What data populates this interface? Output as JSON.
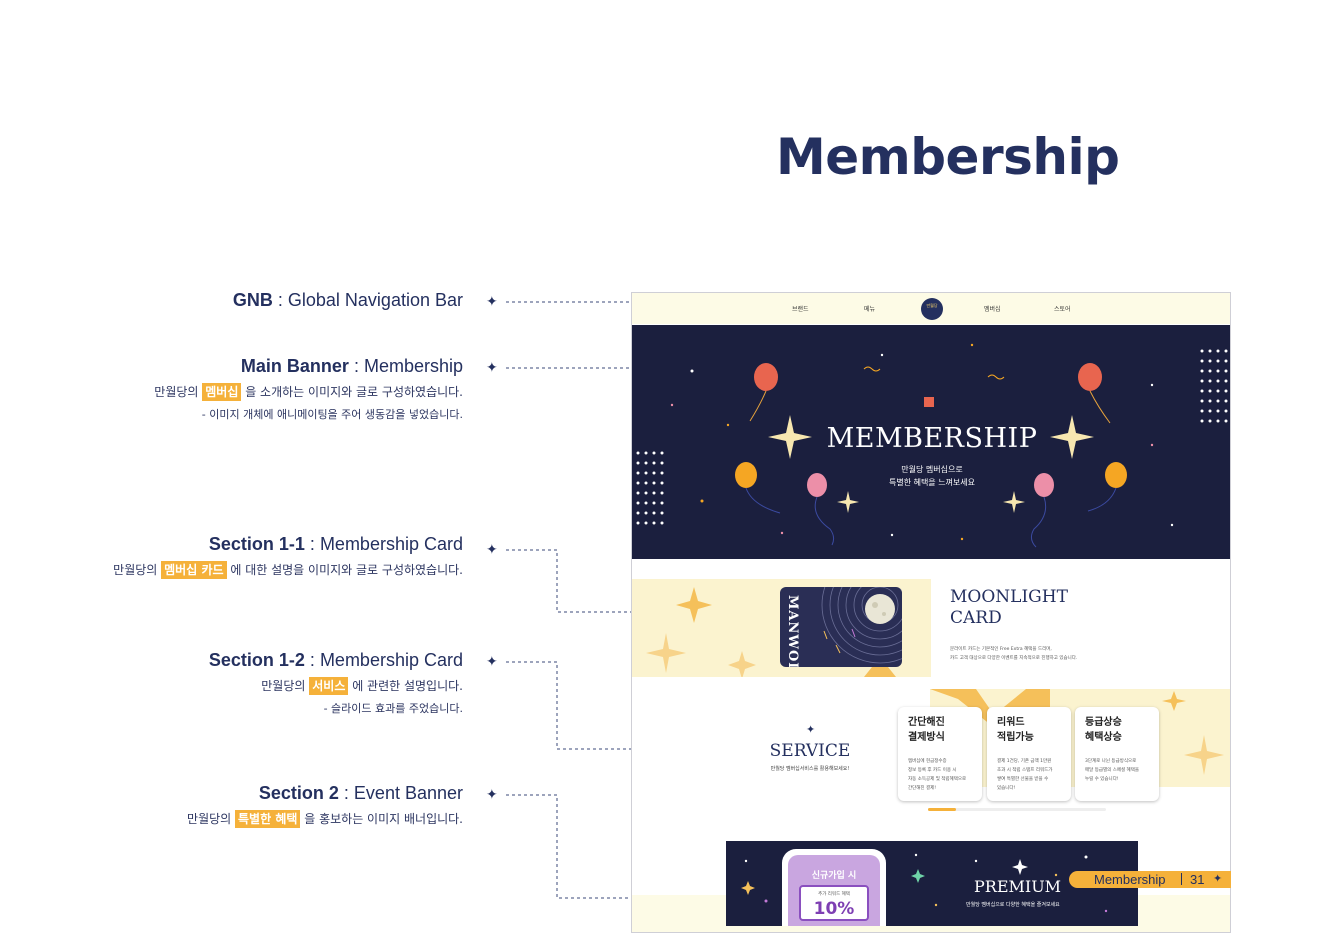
{
  "title": "Membership",
  "annotations": {
    "gnb": {
      "name": "GNB",
      "sep": " : ",
      "desc": "Global Navigation Bar"
    },
    "main_banner": {
      "name": "Main Banner",
      "sep": "  : ",
      "desc": "Membership",
      "line_pre": "만월당의 ",
      "line_hl": "멤버십",
      "line_post": " 을 소개하는 이미지와 글로 구성하였습니다.",
      "note": "- 이미지 개체에 애니메이팅을 주어 생동감을 넣었습니다."
    },
    "section_1_1": {
      "name": "Section 1-1",
      "sep": "  : ",
      "desc": "Membership Card",
      "line_pre": "만월당의 ",
      "line_hl": "멤버십 카드",
      "line_post": " 에 대한 설명을 이미지와 글로 구성하였습니다."
    },
    "section_1_2": {
      "name": "Section 1-2",
      "sep": "  : ",
      "desc": "Membership Card",
      "line_pre": "만월당의 ",
      "line_hl": "서비스",
      "line_post": " 에 관련한 설명입니다.",
      "note": "- 슬라이드 효과를 주었습니다."
    },
    "section_2": {
      "name": "Section 2",
      "sep": "  : ",
      "desc": "Event Banner",
      "line_pre": "만월당의 ",
      "line_hl": "특별한 혜택",
      "line_post": " 을 홍보하는 이미지 배너입니다."
    }
  },
  "mockup": {
    "gnb": {
      "items": [
        "브랜드",
        "메뉴",
        "멤버십",
        "스토어"
      ],
      "logo": "만월당"
    },
    "banner": {
      "title": "MEMBERSHIP",
      "sub_line1": "만월당 멤버십으로",
      "sub_line2": "특별한 혜택을 느껴보세요"
    },
    "card_section": {
      "card_brand": "MANWOL",
      "title_line1": "MOONLIGHT",
      "title_line2": "CARD",
      "desc_line1": "문라이트 카드는 기본적인 Free Extra 혜택을 드리며,",
      "desc_line2": "카드 고객 대상으로 다양한 이벤트를 지속적으로 진행하고 있습니다."
    },
    "service": {
      "title": "SERVICE",
      "sub": "만월당 멤버십서비스를 활용해보세요!",
      "cards": [
        {
          "title": "간단해진\n결제방식",
          "desc": "멤버십에 현금정수증\n정보 등록 후 카드 이용 시\n자동 소득공제 및 적립혜택으로\n간단해진 결제!"
        },
        {
          "title": "리워드\n적립가능",
          "desc": "결제 1건당, 기존 금액 1만원\n초과 시 적립 스탬프 리워드가\n쌓여 특별한 선물을 받을 수\n있습니다!"
        },
        {
          "title": "등급상승\n혜택상승",
          "desc": "3단계로 나뉜 등급방식으로\n매달 등급별의 스페셜 혜택을\n누릴 수 있습니다!"
        }
      ],
      "progress": 0.16
    },
    "event": {
      "phone_head": "신규가입 시",
      "coupon_label": "추가 리워드 혜택",
      "coupon_value": "10%",
      "title": "PREMIUM",
      "sub": "만월당 멤버십으로 다양한 혜택을 즐겨보세요"
    }
  },
  "page_tag": {
    "label": "Membership",
    "number": "31"
  },
  "colors": {
    "navy": "#24305f",
    "accent": "#f5b13a",
    "banner_bg": "#1b1f3e",
    "cream": "#fbf3cf"
  }
}
